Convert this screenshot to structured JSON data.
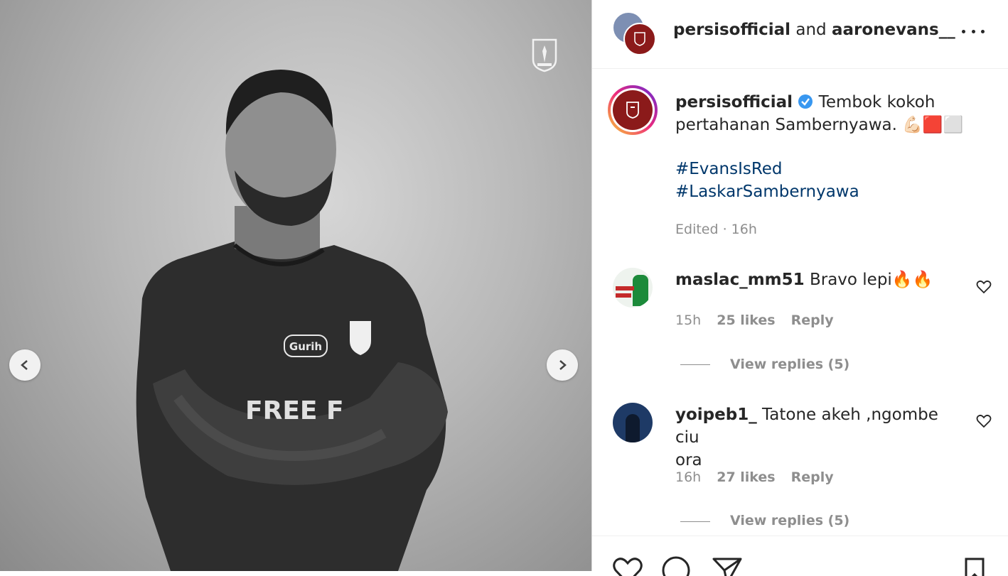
{
  "header": {
    "author_primary": "persisofficial",
    "joiner": "and",
    "author_secondary": "aaronevans__"
  },
  "caption": {
    "username": "persisofficial",
    "text_line1": "Tembok kokoh",
    "text_line2": "pertahanan Sambernyawa. 💪🏻🟥⬜",
    "hashtag1": "#EvansIsRed",
    "hashtag2": "#LaskarSambernyawa",
    "edited": "Edited",
    "time": "16h"
  },
  "comments": [
    {
      "username": "maslac_mm51",
      "text": "Bravo lepi🔥🔥",
      "time": "15h",
      "likes": "25 likes",
      "reply": "Reply",
      "view_replies": "View replies (5)"
    },
    {
      "username": "yoipeb1_",
      "text_line1": "Tatone akeh ,ngombe ciu",
      "text_line2": "ora",
      "time": "16h",
      "likes": "27 likes",
      "reply": "Reply",
      "view_replies": "View replies (5)"
    }
  ],
  "colors": {
    "verified": "#3897f0",
    "hashtag": "#00376b",
    "meta": "#8e8e8e",
    "story_ring_start": "#f9ce34",
    "story_ring_end": "#ee2a7b",
    "club_red": "#8b1a1a"
  },
  "icons": [
    "more-icon",
    "verified-icon",
    "heart-icon",
    "comment-icon",
    "share-icon",
    "bookmark-icon",
    "chevron-left-icon",
    "chevron-right-icon"
  ]
}
